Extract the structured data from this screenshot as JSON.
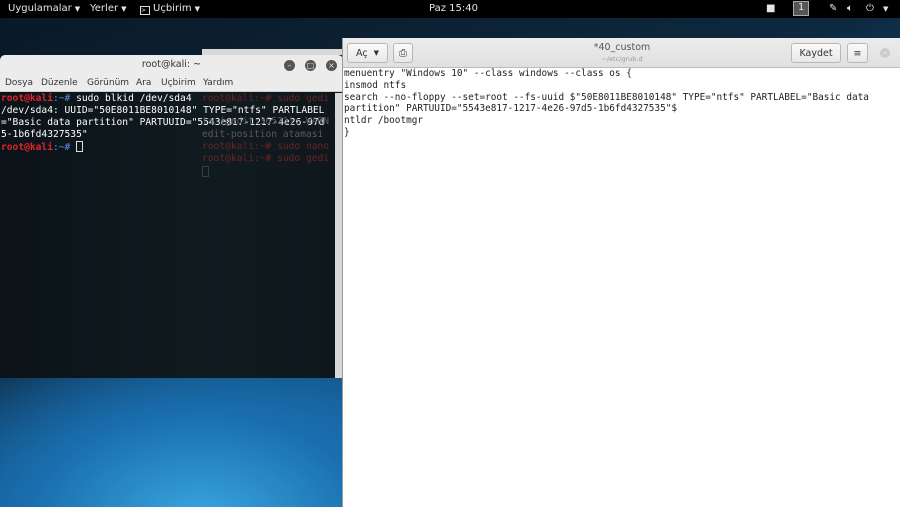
{
  "topbar": {
    "apps": "Uygulamalar",
    "places": "Yerler",
    "terminal": "Uçbirim",
    "clock": "Paz 15:40",
    "workspace": "1"
  },
  "bg_terminal": {
    "lines": [
      "root@kali:~# sudo gedi",
      "ta (gedit:36521): WARN",
      "edit-position atamasi",
      "root@kali:~# sudo nano",
      "root@kali:~# sudo gedi"
    ]
  },
  "terminal": {
    "title": "root@kali: ~",
    "menu": [
      "Dosya",
      "Düzenle",
      "Görünüm",
      "Ara",
      "Uçbirim",
      "Yardım"
    ],
    "prompt_user": "root@kali",
    "prompt_rest": ":~# ",
    "command": "sudo blkid /dev/sda4",
    "output": [
      "/dev/sda4: UUID=\"50E8011BE8010148\" TYPE=\"ntfs\" PARTLABEL",
      "=\"Basic data partition\" PARTUUID=\"5543e817-1217-4e26-97d",
      "5-1b6fd4327535\""
    ]
  },
  "editor": {
    "open_label": "Aç",
    "title": "*40_custom",
    "subtitle": "~/etc/grub.d",
    "save_label": "Kaydet",
    "lines": [
      "menuentry \"Windows 10\" --class windows --class os {",
      "insmod ntfs",
      "search --no-floppy --set=root --fs-uuid $\"50E8011BE8010148\" TYPE=\"ntfs\" PARTLABEL=\"Basic data",
      "partition\" PARTUUID=\"5543e817-1217-4e26-97d5-1b6fd4327535\"$",
      "ntldr /bootmgr",
      "}"
    ]
  }
}
